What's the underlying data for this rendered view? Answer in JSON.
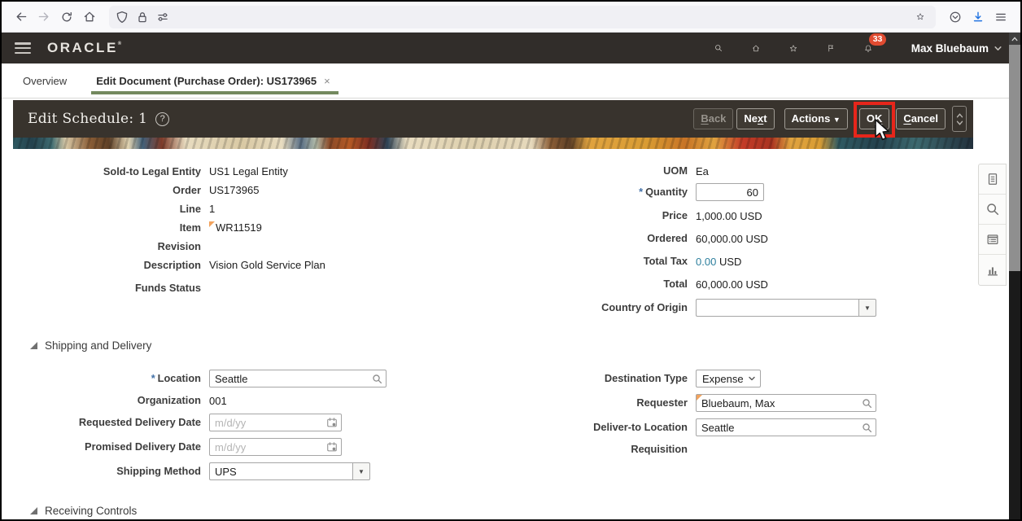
{
  "colors": {
    "app_header_bg": "#312d2a",
    "toolbar_bg": "#38332d",
    "tab_accent_green": "#73895e",
    "annotation_red": "#e7261b",
    "badge_red": "#e04b31",
    "link_blue": "#2d7f9d",
    "download_blue": "#2374e1",
    "required_star_blue": "#4472a8"
  },
  "controls": {
    "required": "*",
    "caret": "▼",
    "close": "×",
    "help": "?"
  },
  "app_header": {
    "brand": "ORACLE",
    "brand_mark": "®",
    "badge_count": "33",
    "user_name": "Max Bluebaum"
  },
  "tabs": {
    "overview": "Overview",
    "active": "Edit Document (Purchase Order): US173965"
  },
  "toolbar": {
    "title": "Edit Schedule: 1",
    "back_key": "B",
    "back_rest": "ack",
    "next_pre": "Ne",
    "next_key": "x",
    "next_post": "t",
    "actions": "Actions",
    "ok_pre": "O",
    "ok_key": "K",
    "cancel_key": "C",
    "cancel_rest": "ancel"
  },
  "summary": {
    "left": {
      "sold_to_label": "Sold-to Legal Entity",
      "sold_to_value": "US1 Legal Entity",
      "order_label": "Order",
      "order_value": "US173965",
      "line_label": "Line",
      "line_value": "1",
      "item_label": "Item",
      "item_value": "WR11519",
      "revision_label": "Revision",
      "revision_value": "",
      "description_label": "Description",
      "description_value": "Vision Gold Service Plan",
      "funds_status_label": "Funds Status",
      "funds_status_value": ""
    },
    "right": {
      "uom_label": "UOM",
      "uom_value": "Ea",
      "quantity_label": "Quantity",
      "quantity_value": "60",
      "price_label": "Price",
      "price_value": "1,000.00 USD",
      "ordered_label": "Ordered",
      "ordered_value": "60,000.00 USD",
      "total_tax_label": "Total Tax",
      "total_tax_link": "0.00",
      "total_tax_currency": "USD",
      "total_label": "Total",
      "total_value": "60,000.00 USD",
      "country_label": "Country of Origin",
      "country_value": ""
    }
  },
  "shipping": {
    "section_title": "Shipping and Delivery",
    "location_label": "Location",
    "location_value": "Seattle",
    "organization_label": "Organization",
    "organization_value": "001",
    "requested_date_label": "Requested Delivery Date",
    "requested_date_placeholder": "m/d/yy",
    "promised_date_label": "Promised Delivery Date",
    "promised_date_placeholder": "m/d/yy",
    "shipping_method_label": "Shipping Method",
    "shipping_method_value": "UPS",
    "destination_type_label": "Destination Type",
    "destination_type_value": "Expense",
    "requester_label": "Requester",
    "requester_value": "Bluebaum, Max",
    "deliver_to_label": "Deliver-to Location",
    "deliver_to_value": "Seattle",
    "requisition_label": "Requisition",
    "requisition_value": ""
  },
  "receiving": {
    "section_title": "Receiving Controls"
  }
}
